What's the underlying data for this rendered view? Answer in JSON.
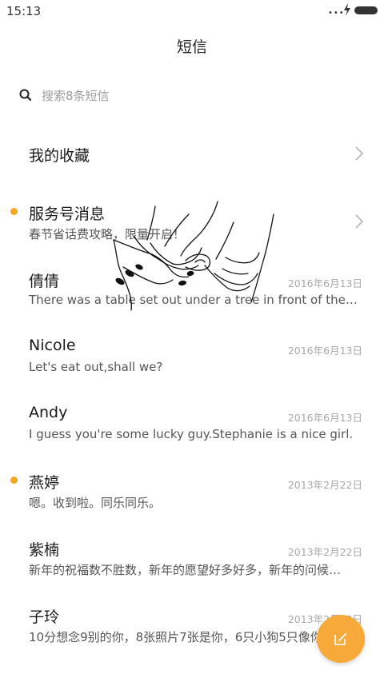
{
  "status_bar": {
    "time": "15:13",
    "dots": "•••",
    "icons": [
      "charging-icon",
      "battery-icon"
    ]
  },
  "header": {
    "title": "短信"
  },
  "search": {
    "placeholder": "搜索8条短信",
    "icon": "search-icon"
  },
  "favorites": {
    "label": "我的收藏",
    "icon": "chevron-right-icon"
  },
  "service": {
    "title": "服务号消息",
    "preview": "春节省话费攻略，限量开启！",
    "unread": true,
    "icon": "chevron-right-icon"
  },
  "conversations": [
    {
      "name": "倩倩",
      "date": "2016年6月13日",
      "preview": "There was a table set out under a tree in front of the house",
      "unread": false
    },
    {
      "name": "Nicole",
      "date": "2016年6月13日",
      "preview": "Let's eat out,shall we?",
      "unread": false
    },
    {
      "name": "Andy",
      "date": "2016年6月13日",
      "preview": "I guess you're some lucky guy.Stephanie is a nice girl.",
      "unread": false
    },
    {
      "name": "燕婷",
      "date": "2013年2月22日",
      "preview": "嗯。收到啦。同乐同乐。",
      "unread": true
    },
    {
      "name": "紫楠",
      "date": "2013年2月22日",
      "preview": "新年的祝福数不胜数，新年的愿望好多好多，新年的问候发个不停",
      "unread": false
    },
    {
      "name": "子玲",
      "date": "2013年2月22日",
      "preview": "10分想念9别的你，8张照片7张是你，6只小狗5只像你",
      "unread": false
    }
  ],
  "fab": {
    "icon": "compose-icon"
  },
  "colors": {
    "accent": "#f7a93a",
    "unread_dot": "#f5a623",
    "date": "#a8a8a8",
    "title": "#1a1a1a"
  }
}
